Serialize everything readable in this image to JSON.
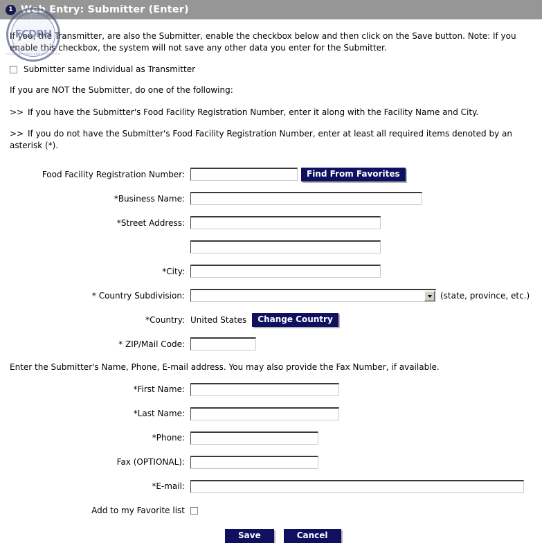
{
  "titlebar": {
    "step_number": "1",
    "title": "Web Entry: Submitter (Enter)",
    "bg_color": "#969696",
    "badge_color": "#131a4f"
  },
  "watermark": {
    "seal_label": "FCDRH",
    "arc_top": "DEPARTMENT OF HEALTH AND HUMAN SERVICES",
    "arc_bottom": "FOOD AND DRUG ADMINISTRATION",
    "color": "#4a5490"
  },
  "instructions": {
    "intro": "If you, the Transmitter, are also the Submitter, enable the checkbox below and then click on the Save button. Note: If you enable this checkbox, the system will not save any other data you enter for the Submitter.",
    "same_as_transmitter_label": "Submitter same Individual as Transmitter",
    "not_submitter": "If you are NOT the Submitter, do one of the following:",
    "bullet_mark": ">>",
    "bullet_1": "If you have the Submitter's Food Facility Registration Number, enter it along with the Facility Name and City.",
    "bullet_2": "If you do not have the Submitter's Food Facility Registration Number, enter at least all required items denoted by an asterisk (*).",
    "contact_note": "Enter the Submitter's Name, Phone, E-mail address. You may also provide the Fax Number, if available."
  },
  "form": {
    "ffrn_label": "Food Facility Registration Number:",
    "ffrn_value": "",
    "find_from_favorites_label": "Find From Favorites",
    "business_name_label": "*Business Name:",
    "business_name_value": "",
    "street_address_label": "*Street Address:",
    "street_address_value": "",
    "street_address2_value": "",
    "city_label": "*City:",
    "city_value": "",
    "country_subdivision_label": "* Country Subdivision:",
    "country_subdivision_value": "",
    "country_subdivision_hint": "(state, province, etc.)",
    "country_label": "*Country:",
    "country_value": "United States",
    "change_country_label": "Change Country",
    "zip_label": "* ZIP/Mail Code:",
    "zip_value": "",
    "first_name_label": "*First Name:",
    "first_name_value": "",
    "last_name_label": "*Last Name:",
    "last_name_value": "",
    "phone_label": "*Phone:",
    "phone_value": "",
    "fax_label": "Fax (OPTIONAL):",
    "fax_value": "",
    "email_label": "*E-mail:",
    "email_value": "",
    "favorite_label": "Add to my Favorite list"
  },
  "buttons": {
    "save_label": "Save",
    "cancel_label": "Cancel",
    "navy_color": "#0f1060"
  }
}
